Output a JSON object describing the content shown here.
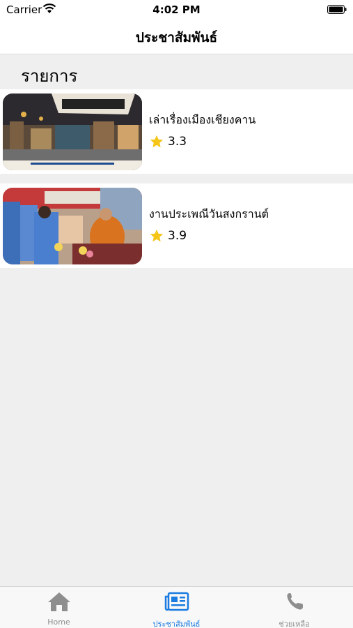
{
  "status_bar": {
    "carrier": "Carrier",
    "time": "4:02 PM"
  },
  "nav": {
    "title": "ประชาสัมพันธ์"
  },
  "section": {
    "title": "รายการ"
  },
  "items": [
    {
      "title": "เล่าเรื่องเมืองเชียงคาน",
      "rating": "3.3",
      "image": "chiang-khan-street-photo"
    },
    {
      "title": "งานประเพณีวันสงกรานต์",
      "rating": "3.9",
      "image": "songkran-ceremony-photo"
    }
  ],
  "tabs": [
    {
      "label": "Home",
      "icon": "home-icon"
    },
    {
      "label": "ประชาสัมพันธ์",
      "icon": "newspaper-icon",
      "active": true
    },
    {
      "label": "ช่วยเหลือ",
      "icon": "phone-icon"
    }
  ],
  "colors": {
    "accent": "#1a7be0",
    "star": "#f5c518",
    "inactive_tab": "#8e8e8e"
  }
}
